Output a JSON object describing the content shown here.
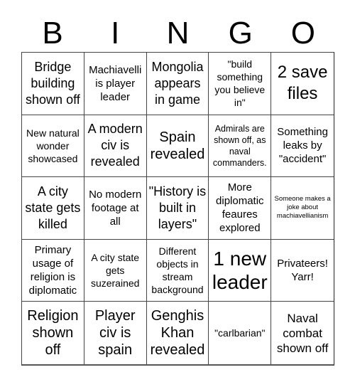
{
  "header": {
    "letters": [
      "B",
      "I",
      "N",
      "G",
      "O"
    ]
  },
  "board": {
    "cells": [
      "Bridge building shown off",
      "Machiavelli is player leader",
      "Mongolia appears in game",
      "\"build something you believe in\"",
      "2 save files",
      "New natural wonder showcased",
      "A modern civ is revealed",
      "Spain revealed",
      "Admirals are shown off, as naval commanders.",
      "Something leaks by \"accident\"",
      "A city state gets killed",
      "No modern footage at all",
      "\"History is built in layers\"",
      "More diplomatic feaures explored",
      "Someone makes a joke about machiavellianism",
      "Primary usage of religion is diplomatic",
      "A city state gets suzerained",
      "Different objects in stream background",
      "1 new leader",
      "Privateers! Yarr!",
      "Religion shown off",
      "Player civ is spain",
      "Genghis Khan revealed",
      "\"carlbarian\"",
      "Naval combat shown off"
    ]
  }
}
